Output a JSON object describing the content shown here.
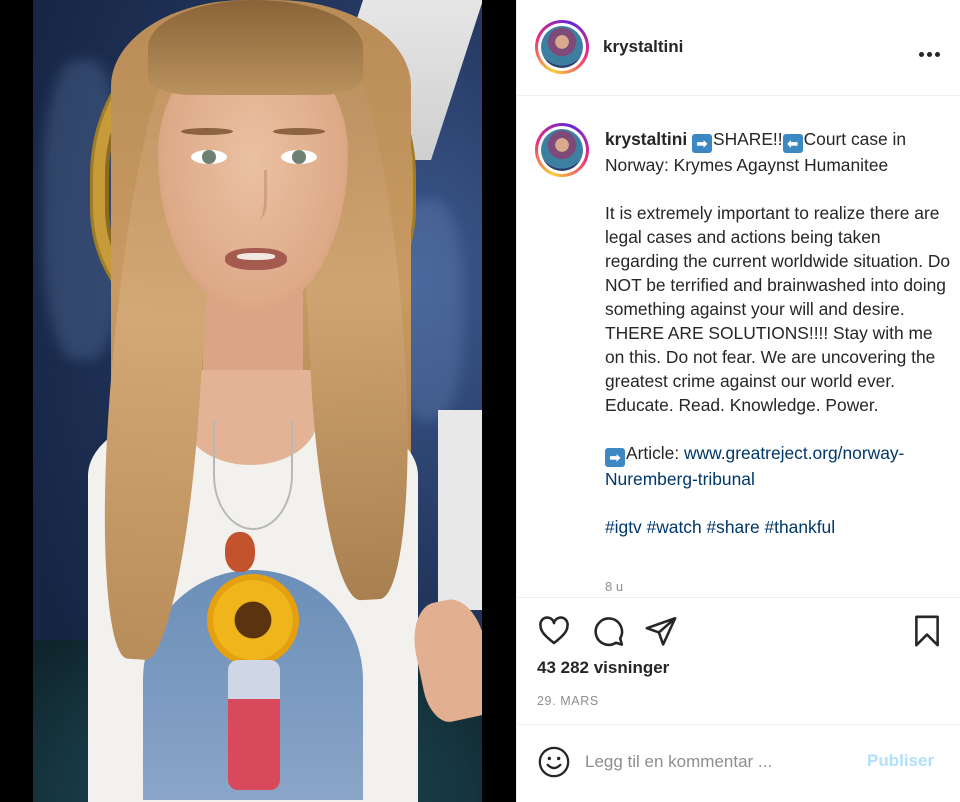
{
  "post": {
    "username": "krystaltini",
    "caption": {
      "title_after_share": "SHARE!!",
      "title_rest": "Court case in Norway: Krymes Agaynst Humanitee",
      "body": "It is extremely important to realize there are legal cases and actions being taken regarding the current worldwide situation. Do NOT be terrified and brainwashed into doing something against your will and desire. THERE ARE SOLUTIONS!!!! Stay with me on this. Do not fear. We are uncovering the greatest crime against our world ever. Educate. Read. Knowledge. Power.",
      "article_label": "Article: ",
      "article_link": "www.greatreject.org/norway-Nuremberg-tribunal",
      "hashtags": "#igtv #watch #share #thankful",
      "time_ago": "8 u"
    },
    "views": "43 282 visninger",
    "date": "29. MARS"
  },
  "comment": {
    "placeholder": "Legg til en kommentar ...",
    "publish_label": "Publiser"
  },
  "icons": [
    "more-icon",
    "heart-icon",
    "comment-icon",
    "share-icon",
    "bookmark-icon",
    "emoji-icon",
    "arrow-right-icon",
    "arrow-left-icon"
  ],
  "colors": {
    "link": "#00376b",
    "publish_disabled": "#b2dffc",
    "meta_gray": "#8e8e8e"
  }
}
